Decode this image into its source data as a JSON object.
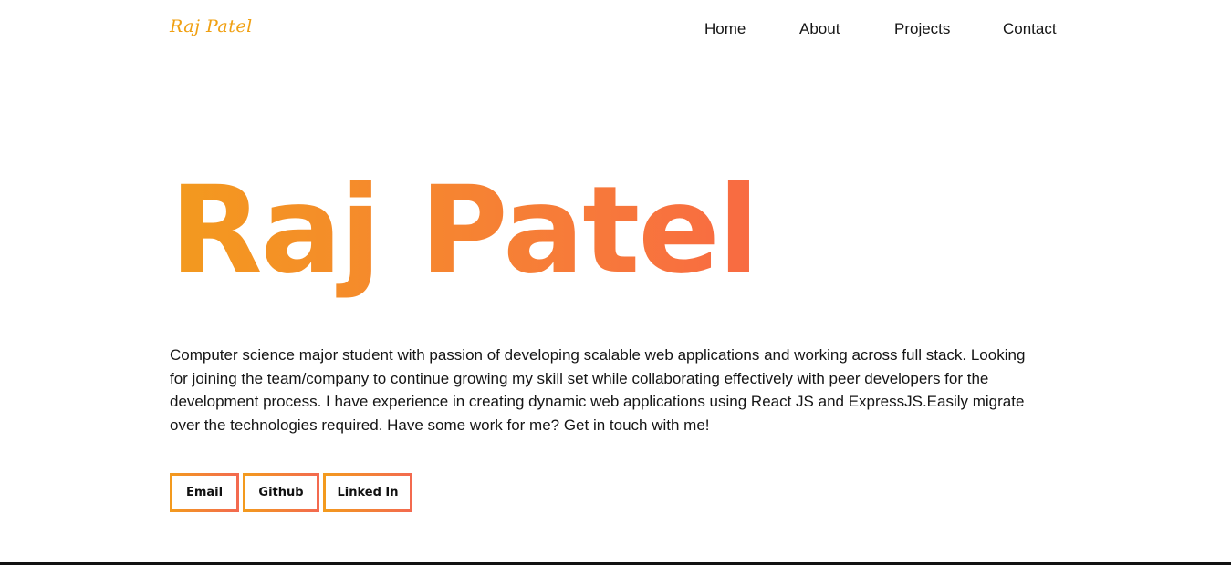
{
  "navbar": {
    "logo": "Raj Patel",
    "links": [
      "Home",
      "About",
      "Projects",
      "Contact"
    ]
  },
  "hero": {
    "name": "Raj Patel",
    "bio": "Computer science major student with passion of developing scalable web applications and working across full stack. Looking for joining the team/company to continue growing my skill set while collaborating effectively with peer developers for the development process. I have experience in creating dynamic web applications using React JS and ExpressJS.Easily migrate over the technologies required. Have some work for me? Get in touch with me!",
    "buttons": [
      "Email",
      "Github",
      "Linked In"
    ]
  },
  "colors": {
    "accent_start": "#f39a1e",
    "accent_end": "#f36a4f",
    "text": "#151515",
    "background": "#ffffff"
  }
}
